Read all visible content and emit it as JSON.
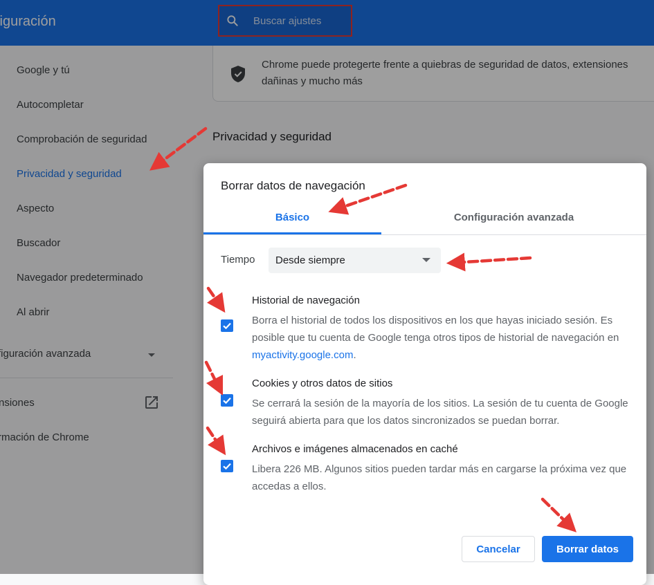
{
  "header": {
    "title": "figuración",
    "search": {
      "placeholder": "Buscar ajustes",
      "icon": "search-icon"
    }
  },
  "sidebar": {
    "items": [
      {
        "label": "Google y tú"
      },
      {
        "label": "Autocompletar"
      },
      {
        "label": "Comprobación de seguridad"
      },
      {
        "label": "Privacidad y seguridad",
        "active": true
      },
      {
        "label": "Aspecto"
      },
      {
        "label": "Buscador"
      },
      {
        "label": "Navegador predeterminado"
      },
      {
        "label": "Al abrir"
      }
    ],
    "advanced_label": "figuración avanzada",
    "extensions_label": "nsiones",
    "about_label": "rmación de Chrome"
  },
  "main": {
    "card_text": "Chrome puede protegerte frente a quiebras de seguridad de datos, extensiones dañinas y mucho más",
    "section_title": "Privacidad y seguridad"
  },
  "dialog": {
    "title": "Borrar datos de navegación",
    "tabs": [
      {
        "label": "Básico",
        "active": true
      },
      {
        "label": "Configuración avanzada"
      }
    ],
    "time_label": "Tiempo",
    "time_value": "Desde siempre",
    "options": [
      {
        "title": "Historial de navegación",
        "desc_before_link": "Borra el historial de todos los dispositivos en los que hayas iniciado sesión. Es posible que tu cuenta de Google tenga otros tipos de historial de navegación en ",
        "link": "myactivity.google.com",
        "desc_after_link": ".",
        "checked": true
      },
      {
        "title": "Cookies y otros datos de sitios",
        "desc": "Se cerrará la sesión de la mayoría de los sitios. La sesión de tu cuenta de Google seguirá abierta para que los datos sincronizados se puedan borrar.",
        "checked": true
      },
      {
        "title": "Archivos e imágenes almacenados en caché",
        "desc": "Libera 226 MB. Algunos sitios pueden tardar más en cargarse la próxima vez que accedas a ellos.",
        "checked": true
      }
    ],
    "cancel_label": "Cancelar",
    "confirm_label": "Borrar datos"
  },
  "colors": {
    "brand": "#1a73e8",
    "annotation": "#e53935"
  }
}
